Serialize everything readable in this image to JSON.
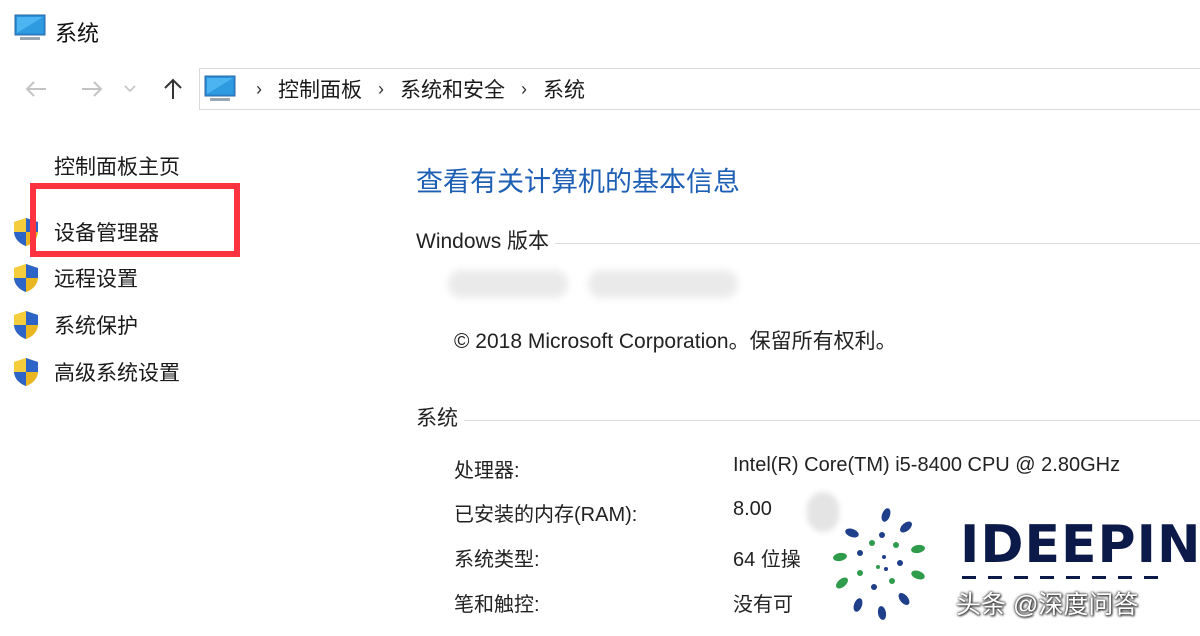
{
  "window": {
    "title": "系统"
  },
  "nav": {
    "breadcrumb": [
      "控制面板",
      "系统和安全",
      "系统"
    ],
    "separator": "›"
  },
  "sidebar": {
    "home": "控制面板主页",
    "items": [
      {
        "label": "设备管理器",
        "icon": "shield-icon"
      },
      {
        "label": "远程设置",
        "icon": "shield-icon"
      },
      {
        "label": "系统保护",
        "icon": "shield-icon"
      },
      {
        "label": "高级系统设置",
        "icon": "shield-icon"
      }
    ],
    "highlight_color": "#ff3340"
  },
  "main": {
    "title": "查看有关计算机的基本信息",
    "title_color": "#1d5fb4",
    "windows_section": {
      "heading": "Windows 版本",
      "copyright": "© 2018 Microsoft Corporation。保留所有权利。"
    },
    "system_section": {
      "heading": "系统",
      "rows": [
        {
          "label": "处理器:",
          "value": "Intel(R) Core(TM) i5-8400 CPU @ 2.80GHz"
        },
        {
          "label": "已安装的内存(RAM):",
          "value": "8.00"
        },
        {
          "label": "系统类型:",
          "value": "64 位操"
        },
        {
          "label": "笔和触控:",
          "value": "没有可"
        }
      ]
    }
  },
  "watermark": {
    "brand": "IDEEPIN",
    "caption": "头条 @深度问答",
    "brand_color": "#0c1a4a"
  }
}
